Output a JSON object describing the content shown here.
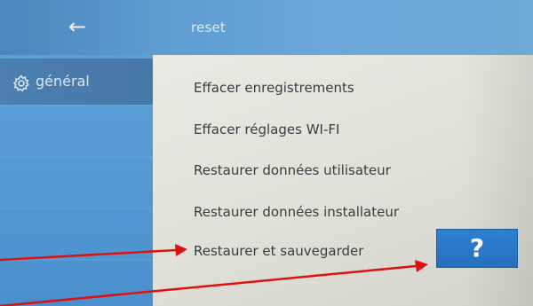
{
  "header": {
    "back_icon": "arrow-left-icon",
    "title": "reset"
  },
  "sidebar": {
    "items": [
      {
        "label": "général",
        "icon": "gear-icon"
      }
    ]
  },
  "menu": {
    "items": [
      "Effacer enregistrements",
      "Effacer réglages WI-FI",
      "Restaurer données utilisateur",
      "Restaurer données installateur",
      "Restaurer et sauvegarder"
    ]
  },
  "help_button": {
    "label": "?"
  },
  "colors": {
    "header": "#5d9bd1",
    "sidebar": "#5399d4",
    "sidebar_selected": "#4b7fb0",
    "content_bg": "#e3e4dc",
    "help_button": "#2a78c8",
    "annotation_arrow": "#e01010"
  }
}
